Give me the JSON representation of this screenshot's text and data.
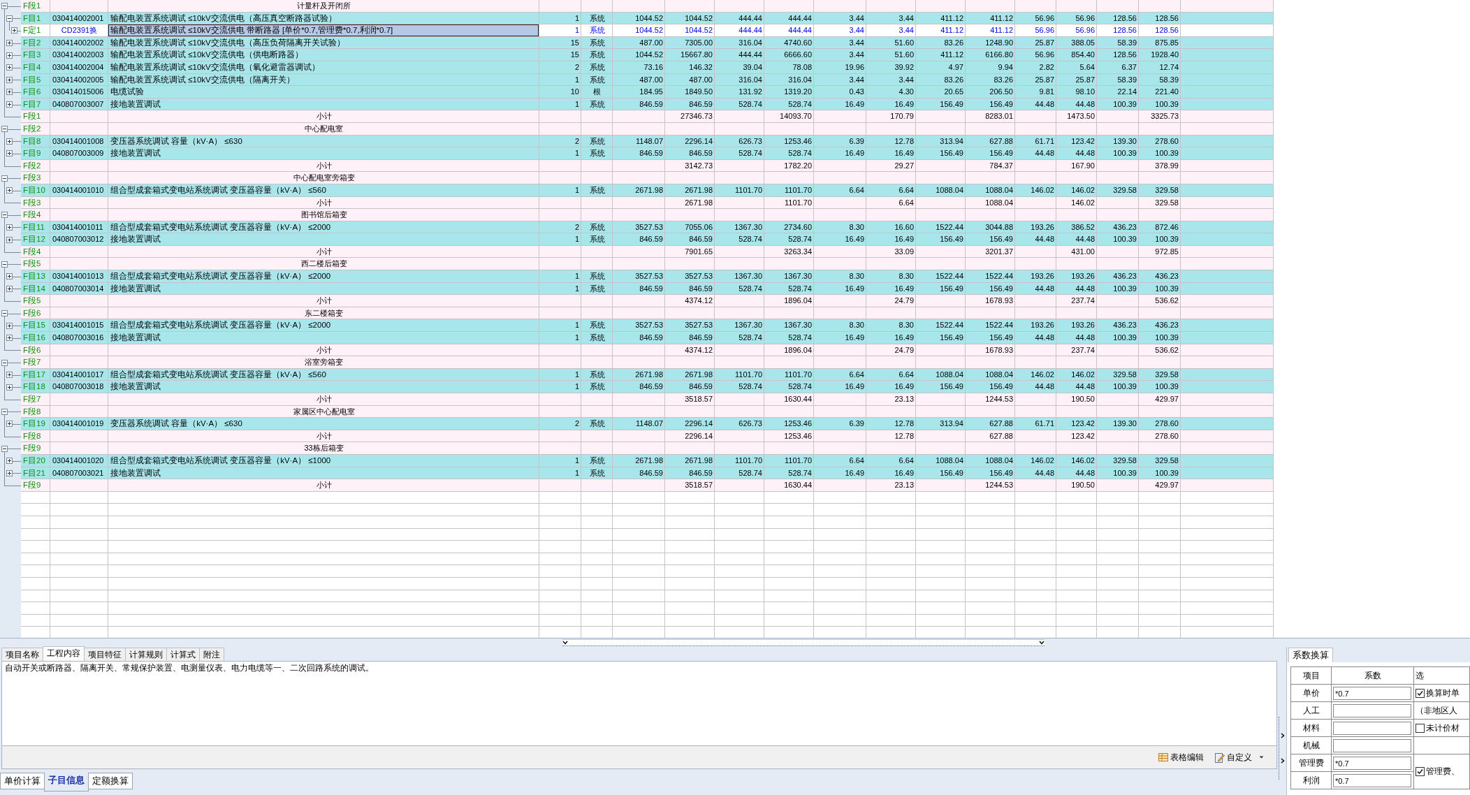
{
  "table": {
    "sections": [
      {
        "label": "F段1",
        "title": "计量杆及开闭所",
        "expanded": true,
        "items": [
          {
            "label": "F目1",
            "code": "030414002001",
            "name": "输配电装置系统调试 ≤10kV交流供电（高压真空断路器试验）",
            "qty": "1",
            "unit": "系统",
            "values": [
              "1044.52",
              "1044.52",
              "444.44",
              "444.44",
              "3.44",
              "3.44",
              "411.12",
              "411.12",
              "56.96",
              "56.96",
              "128.56",
              "128.56"
            ],
            "expanded": true,
            "selected": false,
            "children": [
              {
                "label": "F定1",
                "code": "CD2391换",
                "name": "输配电装置系统调试 ≤10kV交流供电 带断路器 [单价*0.7,管理费*0.7,利润*0.7]",
                "qty": "1",
                "unit": "系统",
                "values": [
                  "1044.52",
                  "1044.52",
                  "444.44",
                  "444.44",
                  "3.44",
                  "3.44",
                  "411.12",
                  "411.12",
                  "56.96",
                  "56.96",
                  "128.56",
                  "128.56"
                ],
                "expanded": false,
                "selected": true
              }
            ]
          },
          {
            "label": "F目2",
            "code": "030414002002",
            "name": "输配电装置系统调试 ≤10kV交流供电（高压负荷隔离开关试验）",
            "qty": "15",
            "unit": "系统",
            "values": [
              "487.00",
              "7305.00",
              "316.04",
              "4740.60",
              "3.44",
              "51.60",
              "83.26",
              "1248.90",
              "25.87",
              "388.05",
              "58.39",
              "875.85"
            ],
            "expanded": false,
            "selected": false
          },
          {
            "label": "F目3",
            "code": "030414002003",
            "name": "输配电装置系统调试 ≤10kV交流供电（供电断路器）",
            "qty": "15",
            "unit": "系统",
            "values": [
              "1044.52",
              "15667.80",
              "444.44",
              "6666.60",
              "3.44",
              "51.60",
              "411.12",
              "6166.80",
              "56.96",
              "854.40",
              "128.56",
              "1928.40"
            ],
            "expanded": false,
            "selected": false
          },
          {
            "label": "F目4",
            "code": "030414002004",
            "name": "输配电装置系统调试 ≤10kV交流供电（氧化避雷器调试）",
            "qty": "2",
            "unit": "系统",
            "values": [
              "73.16",
              "146.32",
              "39.04",
              "78.08",
              "19.96",
              "39.92",
              "4.97",
              "9.94",
              "2.82",
              "5.64",
              "6.37",
              "12.74"
            ],
            "expanded": false,
            "selected": false
          },
          {
            "label": "F目5",
            "code": "030414002005",
            "name": "输配电装置系统调试 ≤10kV交流供电（隔离开关）",
            "qty": "1",
            "unit": "系统",
            "values": [
              "487.00",
              "487.00",
              "316.04",
              "316.04",
              "3.44",
              "3.44",
              "83.26",
              "83.26",
              "25.87",
              "25.87",
              "58.39",
              "58.39"
            ],
            "expanded": false,
            "selected": false
          },
          {
            "label": "F目6",
            "code": "030414015006",
            "name": "电缆试验",
            "qty": "10",
            "unit": "根",
            "values": [
              "184.95",
              "1849.50",
              "131.92",
              "1319.20",
              "0.43",
              "4.30",
              "20.65",
              "206.50",
              "9.81",
              "98.10",
              "22.14",
              "221.40"
            ],
            "expanded": false,
            "selected": false
          },
          {
            "label": "F目7",
            "code": "040807003007",
            "name": "接地装置调试",
            "qty": "1",
            "unit": "系统",
            "values": [
              "846.59",
              "846.59",
              "528.74",
              "528.74",
              "16.49",
              "16.49",
              "156.49",
              "156.49",
              "44.48",
              "44.48",
              "100.39",
              "100.39"
            ],
            "expanded": false,
            "selected": false
          }
        ],
        "subtotal": {
          "label": "F段1",
          "text": "小计",
          "totals": [
            "27346.73",
            "14093.70",
            "170.79",
            "8283.01",
            "1473.50",
            "3325.73"
          ]
        }
      },
      {
        "label": "F段2",
        "title": "中心配电室",
        "expanded": true,
        "items": [
          {
            "label": "F目8",
            "code": "030414001008",
            "name": "变压器系统调试 容量（kV·A） ≤630",
            "qty": "2",
            "unit": "系统",
            "values": [
              "1148.07",
              "2296.14",
              "626.73",
              "1253.46",
              "6.39",
              "12.78",
              "313.94",
              "627.88",
              "61.71",
              "123.42",
              "139.30",
              "278.60"
            ],
            "expanded": false,
            "selected": false
          },
          {
            "label": "F目9",
            "code": "040807003009",
            "name": "接地装置调试",
            "qty": "1",
            "unit": "系统",
            "values": [
              "846.59",
              "846.59",
              "528.74",
              "528.74",
              "16.49",
              "16.49",
              "156.49",
              "156.49",
              "44.48",
              "44.48",
              "100.39",
              "100.39"
            ],
            "expanded": false,
            "selected": false
          }
        ],
        "subtotal": {
          "label": "F段2",
          "text": "小计",
          "totals": [
            "3142.73",
            "1782.20",
            "29.27",
            "784.37",
            "167.90",
            "378.99"
          ]
        }
      },
      {
        "label": "F段3",
        "title": "中心配电室旁箱变",
        "expanded": true,
        "items": [
          {
            "label": "F目10",
            "code": "030414001010",
            "name": "组合型成套箱式变电站系统调试 变压器容量（kV·A） ≤560",
            "qty": "1",
            "unit": "系统",
            "values": [
              "2671.98",
              "2671.98",
              "1101.70",
              "1101.70",
              "6.64",
              "6.64",
              "1088.04",
              "1088.04",
              "146.02",
              "146.02",
              "329.58",
              "329.58"
            ],
            "expanded": false,
            "selected": false
          }
        ],
        "subtotal": {
          "label": "F段3",
          "text": "小计",
          "totals": [
            "2671.98",
            "1101.70",
            "6.64",
            "1088.04",
            "146.02",
            "329.58"
          ]
        }
      },
      {
        "label": "F段4",
        "title": "图书馆后箱变",
        "expanded": true,
        "items": [
          {
            "label": "F目11",
            "code": "030414001011",
            "name": "组合型成套箱式变电站系统调试 变压器容量（kV·A） ≤2000",
            "qty": "2",
            "unit": "系统",
            "values": [
              "3527.53",
              "7055.06",
              "1367.30",
              "2734.60",
              "8.30",
              "16.60",
              "1522.44",
              "3044.88",
              "193.26",
              "386.52",
              "436.23",
              "872.46"
            ],
            "expanded": false,
            "selected": false
          },
          {
            "label": "F目12",
            "code": "040807003012",
            "name": "接地装置调试",
            "qty": "1",
            "unit": "系统",
            "values": [
              "846.59",
              "846.59",
              "528.74",
              "528.74",
              "16.49",
              "16.49",
              "156.49",
              "156.49",
              "44.48",
              "44.48",
              "100.39",
              "100.39"
            ],
            "expanded": false,
            "selected": false
          }
        ],
        "subtotal": {
          "label": "F段4",
          "text": "小计",
          "totals": [
            "7901.65",
            "3263.34",
            "33.09",
            "3201.37",
            "431.00",
            "972.85"
          ]
        }
      },
      {
        "label": "F段5",
        "title": "西二楼后箱变",
        "expanded": true,
        "items": [
          {
            "label": "F目13",
            "code": "030414001013",
            "name": "组合型成套箱式变电站系统调试 变压器容量（kV·A） ≤2000",
            "qty": "1",
            "unit": "系统",
            "values": [
              "3527.53",
              "3527.53",
              "1367.30",
              "1367.30",
              "8.30",
              "8.30",
              "1522.44",
              "1522.44",
              "193.26",
              "193.26",
              "436.23",
              "436.23"
            ],
            "expanded": false,
            "selected": false
          },
          {
            "label": "F目14",
            "code": "040807003014",
            "name": "接地装置调试",
            "qty": "1",
            "unit": "系统",
            "values": [
              "846.59",
              "846.59",
              "528.74",
              "528.74",
              "16.49",
              "16.49",
              "156.49",
              "156.49",
              "44.48",
              "44.48",
              "100.39",
              "100.39"
            ],
            "expanded": false,
            "selected": false
          }
        ],
        "subtotal": {
          "label": "F段5",
          "text": "小计",
          "totals": [
            "4374.12",
            "1896.04",
            "24.79",
            "1678.93",
            "237.74",
            "536.62"
          ]
        }
      },
      {
        "label": "F段6",
        "title": "东二楼箱变",
        "expanded": true,
        "items": [
          {
            "label": "F目15",
            "code": "030414001015",
            "name": "组合型成套箱式变电站系统调试 变压器容量（kV·A） ≤2000",
            "qty": "1",
            "unit": "系统",
            "values": [
              "3527.53",
              "3527.53",
              "1367.30",
              "1367.30",
              "8.30",
              "8.30",
              "1522.44",
              "1522.44",
              "193.26",
              "193.26",
              "436.23",
              "436.23"
            ],
            "expanded": false,
            "selected": false
          },
          {
            "label": "F目16",
            "code": "040807003016",
            "name": "接地装置调试",
            "qty": "1",
            "unit": "系统",
            "values": [
              "846.59",
              "846.59",
              "528.74",
              "528.74",
              "16.49",
              "16.49",
              "156.49",
              "156.49",
              "44.48",
              "44.48",
              "100.39",
              "100.39"
            ],
            "expanded": false,
            "selected": false
          }
        ],
        "subtotal": {
          "label": "F段6",
          "text": "小计",
          "totals": [
            "4374.12",
            "1896.04",
            "24.79",
            "1678.93",
            "237.74",
            "536.62"
          ]
        }
      },
      {
        "label": "F段7",
        "title": "浴室旁箱变",
        "expanded": true,
        "items": [
          {
            "label": "F目17",
            "code": "030414001017",
            "name": "组合型成套箱式变电站系统调试 变压器容量（kV·A） ≤560",
            "qty": "1",
            "unit": "系统",
            "values": [
              "2671.98",
              "2671.98",
              "1101.70",
              "1101.70",
              "6.64",
              "6.64",
              "1088.04",
              "1088.04",
              "146.02",
              "146.02",
              "329.58",
              "329.58"
            ],
            "expanded": false,
            "selected": false
          },
          {
            "label": "F目18",
            "code": "040807003018",
            "name": "接地装置调试",
            "qty": "1",
            "unit": "系统",
            "values": [
              "846.59",
              "846.59",
              "528.74",
              "528.74",
              "16.49",
              "16.49",
              "156.49",
              "156.49",
              "44.48",
              "44.48",
              "100.39",
              "100.39"
            ],
            "expanded": false,
            "selected": false
          }
        ],
        "subtotal": {
          "label": "F段7",
          "text": "小计",
          "totals": [
            "3518.57",
            "1630.44",
            "23.13",
            "1244.53",
            "190.50",
            "429.97"
          ]
        }
      },
      {
        "label": "F段8",
        "title": "家属区中心配电室",
        "expanded": true,
        "items": [
          {
            "label": "F目19",
            "code": "030414001019",
            "name": "变压器系统调试 容量（kV·A） ≤630",
            "qty": "2",
            "unit": "系统",
            "values": [
              "1148.07",
              "2296.14",
              "626.73",
              "1253.46",
              "6.39",
              "12.78",
              "313.94",
              "627.88",
              "61.71",
              "123.42",
              "139.30",
              "278.60"
            ],
            "expanded": false,
            "selected": false
          }
        ],
        "subtotal": {
          "label": "F段8",
          "text": "小计",
          "totals": [
            "2296.14",
            "1253.46",
            "12.78",
            "627.88",
            "123.42",
            "278.60"
          ]
        }
      },
      {
        "label": "F段9",
        "title": "33栋后箱变",
        "expanded": true,
        "items": [
          {
            "label": "F目20",
            "code": "030414001020",
            "name": "组合型成套箱式变电站系统调试 变压器容量（kV·A） ≤1000",
            "qty": "1",
            "unit": "系统",
            "values": [
              "2671.98",
              "2671.98",
              "1101.70",
              "1101.70",
              "6.64",
              "6.64",
              "1088.04",
              "1088.04",
              "146.02",
              "146.02",
              "329.58",
              "329.58"
            ],
            "expanded": false,
            "selected": false
          },
          {
            "label": "F目21",
            "code": "040807003021",
            "name": "接地装置调试",
            "qty": "1",
            "unit": "系统",
            "values": [
              "846.59",
              "846.59",
              "528.74",
              "528.74",
              "16.49",
              "16.49",
              "156.49",
              "156.49",
              "44.48",
              "44.48",
              "100.39",
              "100.39"
            ],
            "expanded": false,
            "selected": false
          }
        ],
        "subtotal": {
          "label": "F段9",
          "text": "小计",
          "totals": [
            "3518.57",
            "1630.44",
            "23.13",
            "1244.53",
            "190.50",
            "429.97"
          ]
        }
      }
    ]
  },
  "detail": {
    "tabs": [
      {
        "label": "项目名称",
        "selected": false
      },
      {
        "label": "工程内容",
        "selected": true
      },
      {
        "label": "项目特征",
        "selected": false
      },
      {
        "label": "计算规则",
        "selected": false
      },
      {
        "label": "计算式",
        "selected": false
      },
      {
        "label": "附注",
        "selected": false
      }
    ],
    "content": "自动开关或断路器、隔离开关、常规保护装置、电测量仪表、电力电缆等一、二次回路系统的调试。",
    "tools": [
      {
        "kind": "table",
        "label": "表格编辑"
      },
      {
        "kind": "custom",
        "label": "自定义",
        "dropdown": true
      }
    ]
  },
  "bottom_tabs": [
    {
      "label": "单价计算",
      "selected": false
    },
    {
      "label": "子目信息",
      "selected": true
    },
    {
      "label": "定额换算",
      "selected": false
    }
  ],
  "coefficient_panel": {
    "tab": "系数换算",
    "columns": [
      "项目",
      "系数",
      "选"
    ],
    "rows": [
      {
        "item": "单价",
        "value": "*0.7",
        "option": {
          "kind": "checkbox",
          "label": "换算时单",
          "checked": true,
          "merge_next": false
        }
      },
      {
        "item": "人工",
        "option": {
          "kind": "note",
          "label": "（非地区人",
          "merge_next": false
        }
      },
      {
        "item": "材料",
        "option": {
          "kind": "checkbox",
          "label": "未计价材",
          "checked": false,
          "merge_next": false
        }
      },
      {
        "item": "机械"
      },
      {
        "item": "管理费",
        "value": "*0.7",
        "option": {
          "kind": "checkbox",
          "label": "管理费、",
          "checked": true,
          "merge_next": true
        }
      },
      {
        "item": "利润",
        "value": "*0.7"
      }
    ]
  }
}
